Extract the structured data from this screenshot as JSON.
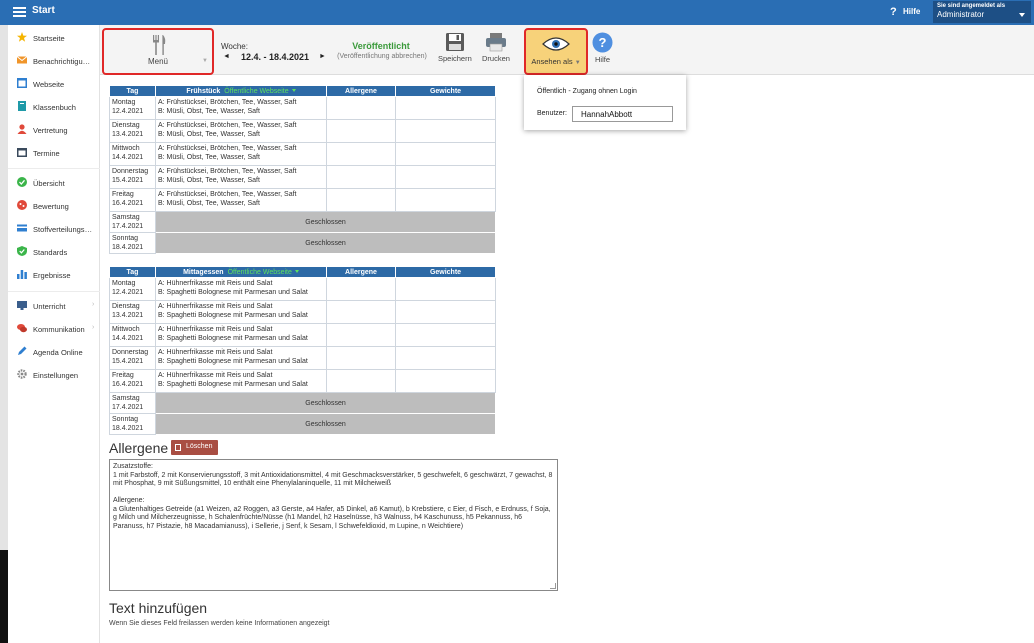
{
  "app": {
    "title": "Start",
    "help": "Hilfe",
    "user_line1": "Sie sind angemeldet als",
    "user_line2": "Administrator"
  },
  "sidebar": {
    "items": [
      {
        "label": "Startseite"
      },
      {
        "label": "Benachrichtigungen"
      },
      {
        "label": "Webseite"
      },
      {
        "label": "Klassenbuch"
      },
      {
        "label": "Vertretung"
      },
      {
        "label": "Termine"
      },
      {
        "label": "Übersicht"
      },
      {
        "label": "Bewertung"
      },
      {
        "label": "Stoffverteilungsplan"
      },
      {
        "label": "Standards"
      },
      {
        "label": "Ergebnisse"
      },
      {
        "label": "Unterricht"
      },
      {
        "label": "Kommunikation"
      },
      {
        "label": "Agenda Online"
      },
      {
        "label": "Einstellungen"
      }
    ]
  },
  "toolbar": {
    "menu_label": "Menü",
    "week_label": "Woche:",
    "week_range": "12.4. - 18.4.2021",
    "status": "Veröffentlicht",
    "cancel_publish": "(Veröffentlichung abbrechen)",
    "save": "Speichern",
    "print": "Drucken",
    "view_as": "Ansehen als",
    "help": "Hilfe"
  },
  "view_popup": {
    "public_option": "Öffentlich - Zugang ohnen Login",
    "user_label": "Benutzer:",
    "user_value": "HannahAbbott"
  },
  "breakfast": {
    "headers": {
      "day": "Tag",
      "meal": "Frühstück",
      "publish": "Öffentliche Webseite",
      "allergens": "Allergene",
      "dishes": "Gewichte"
    },
    "rows": [
      {
        "day": "Montag",
        "date": "12.4.2021",
        "a": "A: Frühstücksei, Brötchen, Tee, Wasser, Saft",
        "b": "B: Müsli, Obst, Tee, Wasser, Saft"
      },
      {
        "day": "Dienstag",
        "date": "13.4.2021",
        "a": "A: Frühstücksei, Brötchen, Tee, Wasser, Saft",
        "b": "B: Müsli, Obst, Tee, Wasser, Saft"
      },
      {
        "day": "Mittwoch",
        "date": "14.4.2021",
        "a": "A: Frühstücksei, Brötchen, Tee, Wasser, Saft",
        "b": "B: Müsli, Obst, Tee, Wasser, Saft"
      },
      {
        "day": "Donnerstag",
        "date": "15.4.2021",
        "a": "A: Frühstücksei, Brötchen, Tee, Wasser, Saft",
        "b": "B: Müsli, Obst, Tee, Wasser, Saft"
      },
      {
        "day": "Freitag",
        "date": "16.4.2021",
        "a": "A: Frühstücksei, Brötchen, Tee, Wasser, Saft",
        "b": "B: Müsli, Obst, Tee, Wasser, Saft"
      }
    ],
    "closed": [
      {
        "day": "Samstag",
        "date": "17.4.2021",
        "text": "Geschlossen"
      },
      {
        "day": "Sonntag",
        "date": "18.4.2021",
        "text": "Geschlossen"
      }
    ]
  },
  "lunch": {
    "headers": {
      "day": "Tag",
      "meal": "Mittagessen",
      "publish": "Öffentliche Webseite",
      "allergens": "Allergene",
      "dishes": "Gewichte"
    },
    "rows": [
      {
        "day": "Montag",
        "date": "12.4.2021",
        "a": "A: Hühnerfrikasse mit Reis und Salat",
        "b": "B: Spaghetti Bolognese mit Parmesan und Salat"
      },
      {
        "day": "Dienstag",
        "date": "13.4.2021",
        "a": "A: Hühnerfrikasse mit Reis und Salat",
        "b": "B: Spaghetti Bolognese mit Parmesan und Salat"
      },
      {
        "day": "Mittwoch",
        "date": "14.4.2021",
        "a": "A: Hühnerfrikasse mit Reis und Salat",
        "b": "B: Spaghetti Bolognese mit Parmesan und Salat"
      },
      {
        "day": "Donnerstag",
        "date": "15.4.2021",
        "a": "A: Hühnerfrikasse mit Reis und Salat",
        "b": "B: Spaghetti Bolognese mit Parmesan und Salat"
      },
      {
        "day": "Freitag",
        "date": "16.4.2021",
        "a": "A: Hühnerfrikasse mit Reis und Salat",
        "b": "B: Spaghetti Bolognese mit Parmesan und Salat"
      }
    ],
    "closed": [
      {
        "day": "Samstag",
        "date": "17.4.2021",
        "text": "Geschlossen"
      },
      {
        "day": "Sonntag",
        "date": "18.4.2021",
        "text": "Geschlossen"
      }
    ]
  },
  "allergens": {
    "title": "Allergene",
    "delete": "Löschen",
    "text": "Zusatzstoffe:\n1 mit Farbstoff, 2 mit Konservierungsstoff, 3 mit Antioxidationsmittel, 4 mit Geschmacksverstärker, 5 geschwefelt, 6 geschwärzt, 7 gewachst, 8 mit Phosphat, 9 mit Süßungsmittel, 10 enthält eine Phenylalaninquelle, 11 mit Milcheiweiß\n\nAllergene:\na Glutenhaltiges Getreide (a1 Weizen, a2 Roggen, a3 Gerste, a4 Hafer, a5 Dinkel, a6 Kamut), b Krebstiere, c Eier, d Fisch, e Erdnuss, f Soja, g Milch und Milcherzeugnisse, h Schalenfrüchte/Nüsse (h1 Mandel, h2 Haselnüsse, h3 Walnuss, h4 Kaschunuss, h5 Pekannuss, h6 Paranuss, h7 Pistazie, h8 Macadamianuss), i Sellerie, j Senf, k Sesam, l Schwefeldioxid, m Lupine, n Weichtiere)"
  },
  "add_text": {
    "title": "Text hinzufügen",
    "hint": "Wenn Sie dieses Feld freilassen werden keine Informationen angezeigt"
  },
  "colors": {
    "header_blue": "#2a6eb4",
    "table_header": "#2d6aa6",
    "published_green": "#3b9a3b",
    "highlight_red": "#e02828",
    "view_active": "#f7d27a",
    "delete_btn": "#a94e43"
  }
}
